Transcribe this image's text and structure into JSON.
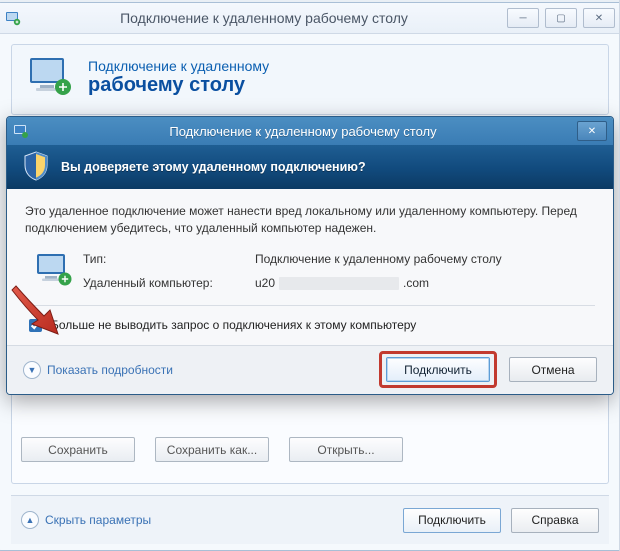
{
  "parent": {
    "title": "Подключение к удаленному рабочему столу",
    "banner_line1": "Подключение к удаленному",
    "banner_line2": "рабочему столу",
    "save": "Сохранить",
    "save_as": "Сохранить как...",
    "open": "Открыть...",
    "collapse": "Скрыть параметры",
    "connect": "Подключить",
    "help": "Справка"
  },
  "dialog": {
    "title": "Подключение к удаленному рабочему столу",
    "banner": "Вы доверяете этому удаленному подключению?",
    "warning": "Это удаленное подключение может нанести вред локальному или удаленному компьютеру. Перед подключением убедитесь, что удаленный компьютер надежен.",
    "type_label": "Тип:",
    "type_value": "Подключение к удаленному рабочему столу",
    "host_label": "Удаленный компьютер:",
    "host_prefix": "u20",
    "host_suffix": ".com",
    "checkbox": "Больше не выводить запрос о подключениях к этому компьютеру",
    "details": "Показать подробности",
    "connect": "Подключить",
    "cancel": "Отмена"
  }
}
